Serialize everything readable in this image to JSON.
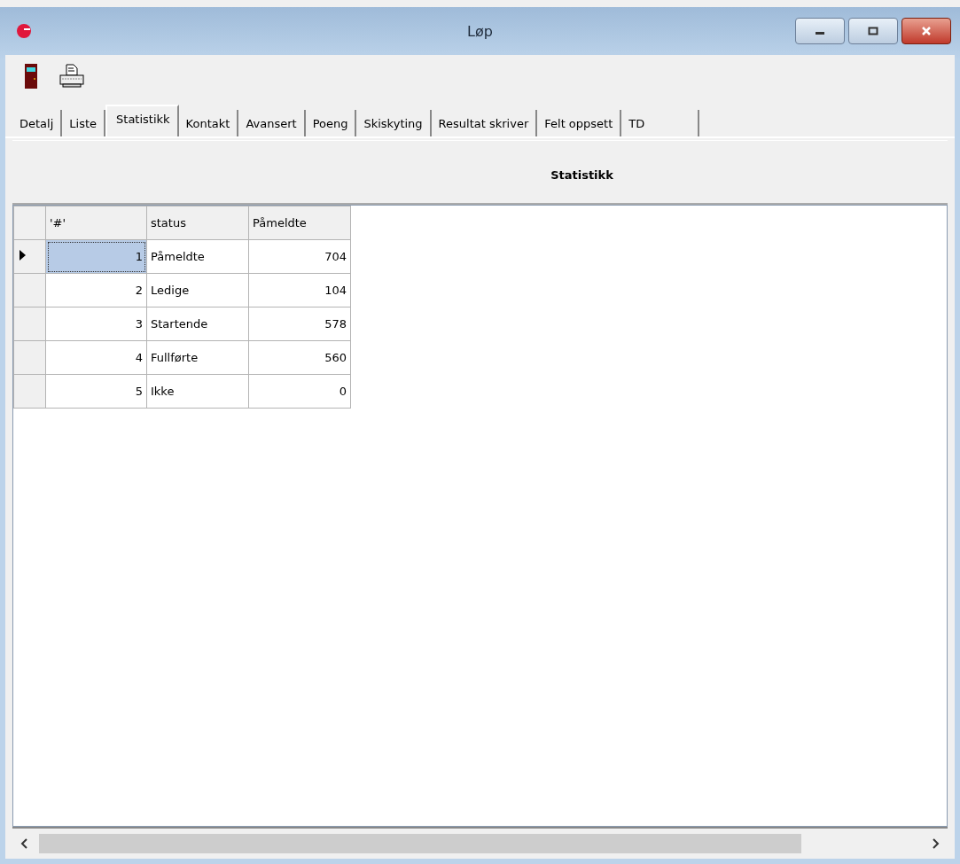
{
  "window": {
    "title": "Løp"
  },
  "tabs": [
    {
      "label": "Detalj",
      "selected": false
    },
    {
      "label": "Liste",
      "selected": false
    },
    {
      "label": "Statistikk",
      "selected": true
    },
    {
      "label": "Kontakt",
      "selected": false
    },
    {
      "label": "Avansert",
      "selected": false
    },
    {
      "label": "Poeng",
      "selected": false
    },
    {
      "label": "Skiskyting",
      "selected": false
    },
    {
      "label": "Resultat skriver",
      "selected": false
    },
    {
      "label": "Felt oppsett",
      "selected": false
    },
    {
      "label": "TD",
      "selected": false
    }
  ],
  "panel": {
    "heading": "Statistikk"
  },
  "table": {
    "columns": [
      "'#'",
      "status",
      "Påmeldte"
    ],
    "rows": [
      {
        "cells": [
          "1",
          "Påmeldte",
          "704"
        ],
        "selected": true
      },
      {
        "cells": [
          "2",
          "Ledige",
          "104"
        ],
        "selected": false
      },
      {
        "cells": [
          "3",
          "Startende",
          "578"
        ],
        "selected": false
      },
      {
        "cells": [
          "4",
          "Fullførte",
          "560"
        ],
        "selected": false
      },
      {
        "cells": [
          "5",
          "Ikke",
          "0"
        ],
        "selected": false
      }
    ]
  }
}
